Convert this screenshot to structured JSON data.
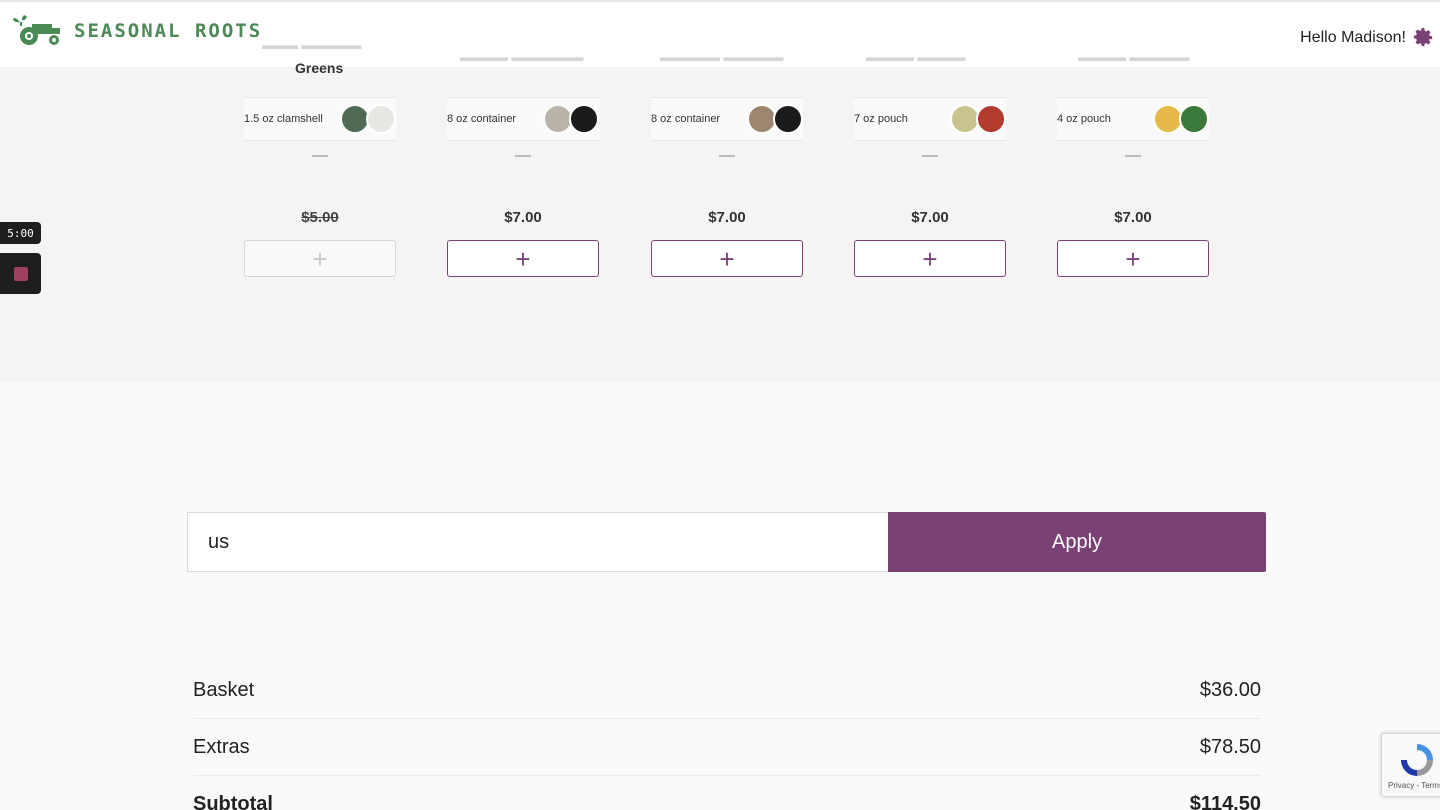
{
  "header": {
    "brand": "SEASONAL ROOTS",
    "greeting": "Hello Madison!",
    "partial_product_title": "Greens"
  },
  "products": [
    {
      "size": "1.5 oz clamshell",
      "quantity_display": "—",
      "price": "$5.00",
      "price_struck": true,
      "add_label": "+",
      "add_disabled": true,
      "thumb_colors": [
        "#4f6b53",
        "#e9e7e3"
      ]
    },
    {
      "size": "8 oz container",
      "quantity_display": "—",
      "price": "$7.00",
      "price_struck": false,
      "add_label": "+",
      "add_disabled": false,
      "thumb_colors": [
        "#b9b3a8",
        "#1b1b1b"
      ]
    },
    {
      "size": "8 oz container",
      "quantity_display": "—",
      "price": "$7.00",
      "price_struck": false,
      "add_label": "+",
      "add_disabled": false,
      "thumb_colors": [
        "#9c8670",
        "#1b1b1b"
      ]
    },
    {
      "size": "7 oz pouch",
      "quantity_display": "—",
      "price": "$7.00",
      "price_struck": false,
      "add_label": "+",
      "add_disabled": false,
      "thumb_colors": [
        "#c9c48e",
        "#b33b2e"
      ]
    },
    {
      "size": "4 oz pouch",
      "quantity_display": "—",
      "price": "$7.00",
      "price_struck": false,
      "add_label": "+",
      "add_disabled": false,
      "thumb_colors": [
        "#e5b84a",
        "#3c7a3c"
      ]
    }
  ],
  "recorder": {
    "timer": "5:00"
  },
  "promo": {
    "input_value": "us",
    "apply_label": "Apply"
  },
  "totals": [
    {
      "label": "Basket",
      "amount": "$36.00"
    },
    {
      "label": "Extras",
      "amount": "$78.50"
    },
    {
      "label": "Subtotal",
      "amount": "$114.50"
    }
  ],
  "recaptcha": {
    "links": "Privacy - Terms"
  },
  "colors": {
    "brand_green": "#4c8a55",
    "accent_purple": "#7a4174"
  }
}
